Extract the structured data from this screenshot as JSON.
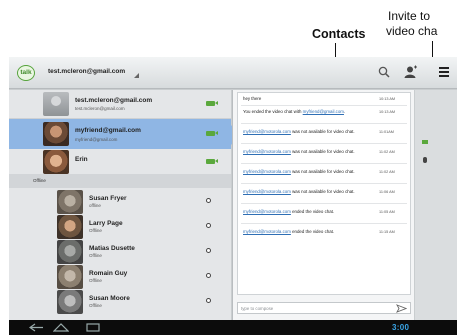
{
  "annotations": {
    "contacts_label": "Contacts",
    "invite_line1": "Invite to",
    "invite_line2": "video cha"
  },
  "topbar": {
    "logo": "talk",
    "account": "test.mcleron@gmail.com",
    "icons": [
      "search-icon",
      "add-contact-icon",
      "menu-icon"
    ]
  },
  "contacts": {
    "online": [
      {
        "name": "test.mcleron@gmail.com",
        "status": "test.mcleron@gmail.com",
        "presence": "video"
      },
      {
        "name": "myfriend@gmail.com",
        "status": "myfriend@gmail.com",
        "presence": "video",
        "selected": true
      },
      {
        "name": "Erin",
        "status": "",
        "presence": "video"
      }
    ],
    "offline_header": "Offline",
    "offline": [
      {
        "name": "Susan Fryer",
        "status": "offline"
      },
      {
        "name": "Larry Page",
        "status": "Offline"
      },
      {
        "name": "Matias Dusette",
        "status": "Offline"
      },
      {
        "name": "Romain Guy",
        "status": "Offline"
      },
      {
        "name": "Susan Moore",
        "status": "Offline"
      }
    ]
  },
  "chat": {
    "messages": [
      {
        "pre": "hey there",
        "link": "",
        "post": "",
        "time": "10:13 AM"
      },
      {
        "pre": "You ended the video chat with ",
        "link": "myfriend@gmail.com",
        "post": ".",
        "time": "10:13 AM"
      },
      {
        "pre": "",
        "link": "myfriend@motorola.com",
        "post": " was not available for video chat.",
        "time": "11:01AM"
      },
      {
        "pre": "",
        "link": "myfriend@motorola.com",
        "post": " was not available for video chat.",
        "time": "11:02 AM"
      },
      {
        "pre": "",
        "link": "myfriend@motorola.com",
        "post": " was not available for video chat.",
        "time": "11:02 AM"
      },
      {
        "pre": "",
        "link": "myfriend@motorola.com",
        "post": " was not available for video chat.",
        "time": "11:06 AM"
      },
      {
        "pre": "",
        "link": "myfriend@motorola.com",
        "post": " ended the video chat.",
        "time": "11:05 AM"
      },
      {
        "pre": "",
        "link": "myfriend@motorola.com",
        "post": " ended the video chat.",
        "time": "11:15 AM"
      }
    ],
    "compose_placeholder": "type to compose"
  },
  "systembar": {
    "time": "3:00"
  },
  "colors": {
    "selected_row": "#8fb6e4",
    "video_available": "#5aa83c",
    "link": "#2f6fb5",
    "clock": "#3aa6e8"
  }
}
